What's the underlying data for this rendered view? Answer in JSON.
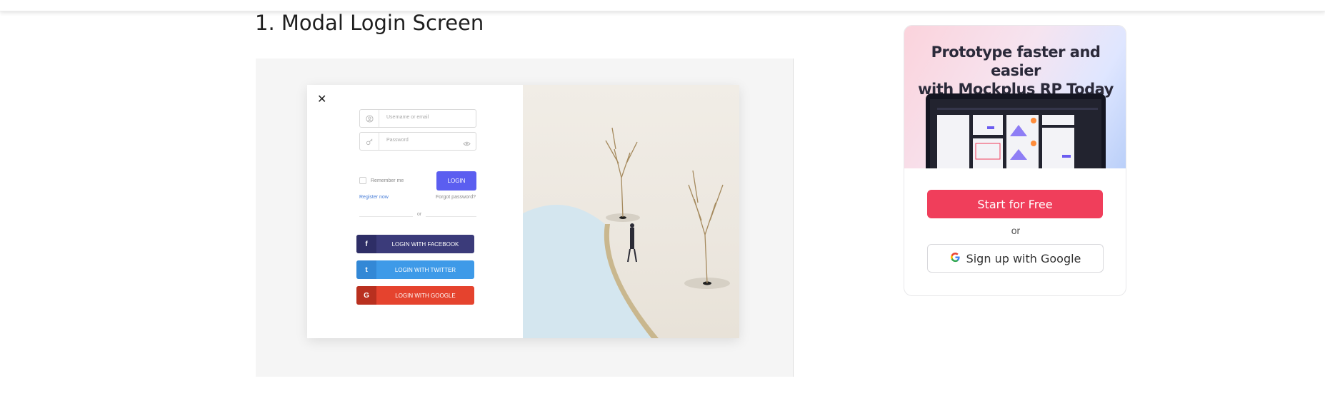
{
  "article": {
    "heading": "1. Modal Login Screen"
  },
  "modal": {
    "close_glyph": "✕",
    "username_placeholder": "Username or email",
    "password_placeholder": "Password",
    "remember_label": "Remember me",
    "login_label": "LOGIN",
    "register_link": "Register now",
    "forgot_link": "Forgot password?",
    "or_text": "or",
    "social": [
      {
        "icon": "facebook-icon",
        "glyph": "f",
        "label": "LOGIN WITH FACEBOOK",
        "color": "#3b3b7a"
      },
      {
        "icon": "twitter-icon",
        "glyph": "t",
        "label": "LOGIN WITH TWITTER",
        "color": "#3e9ae8"
      },
      {
        "icon": "google-icon",
        "glyph": "G",
        "label": "LOGIN WITH GOOGLE",
        "color": "#e5432e"
      }
    ],
    "accent": "#5b5ef0"
  },
  "promo": {
    "title_line1": "Prototype faster and easier",
    "title_line2": "with Mockplus RP Today",
    "start_label": "Start for Free",
    "or_text": "or",
    "google_label": "Sign up with Google",
    "start_color": "#f03e5b"
  }
}
